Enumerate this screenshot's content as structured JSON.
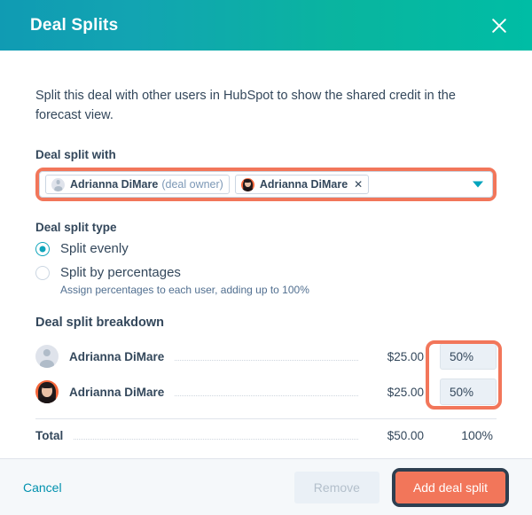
{
  "header": {
    "title": "Deal Splits",
    "close_icon": "close-icon",
    "gradient_from": "#109bb3",
    "gradient_to": "#00bda5"
  },
  "body": {
    "intro": "Split this deal with other users in HubSpot to show the shared credit in the forecast view.",
    "split_with": {
      "label": "Deal split with",
      "highlight_color": "#f2765a",
      "caret_icon": "chevron-down-icon",
      "caret_color": "#00a4bd",
      "tokens": [
        {
          "name": "Adrianna DiMare",
          "suffix": "(deal owner)",
          "avatar": "placeholder-avatar",
          "removable": false
        },
        {
          "name": "Adrianna DiMare",
          "suffix": "",
          "avatar": "photo-avatar",
          "removable": true,
          "remove_icon": "close-icon"
        }
      ]
    },
    "split_type": {
      "label": "Deal split type",
      "accent_color": "#0fa5bb",
      "options": [
        {
          "label": "Split evenly",
          "selected": true,
          "help": ""
        },
        {
          "label": "Split by percentages",
          "selected": false,
          "help": "Assign percentages to each user, adding up to 100%"
        }
      ]
    },
    "breakdown": {
      "title": "Deal split breakdown",
      "highlight_color": "#f2765a",
      "rows": [
        {
          "name": "Adrianna DiMare",
          "amount": "$25.00",
          "percent": "50%",
          "avatar": "placeholder-avatar"
        },
        {
          "name": "Adrianna DiMare",
          "amount": "$25.00",
          "percent": "50%",
          "avatar": "photo-avatar"
        }
      ],
      "total": {
        "label": "Total",
        "amount": "$50.00",
        "percent": "100%"
      }
    }
  },
  "footer": {
    "cancel_label": "Cancel",
    "remove_label": "Remove",
    "primary_label": "Add deal split",
    "primary_color": "#f2765a",
    "primary_highlight_color": "#2e3f50"
  }
}
